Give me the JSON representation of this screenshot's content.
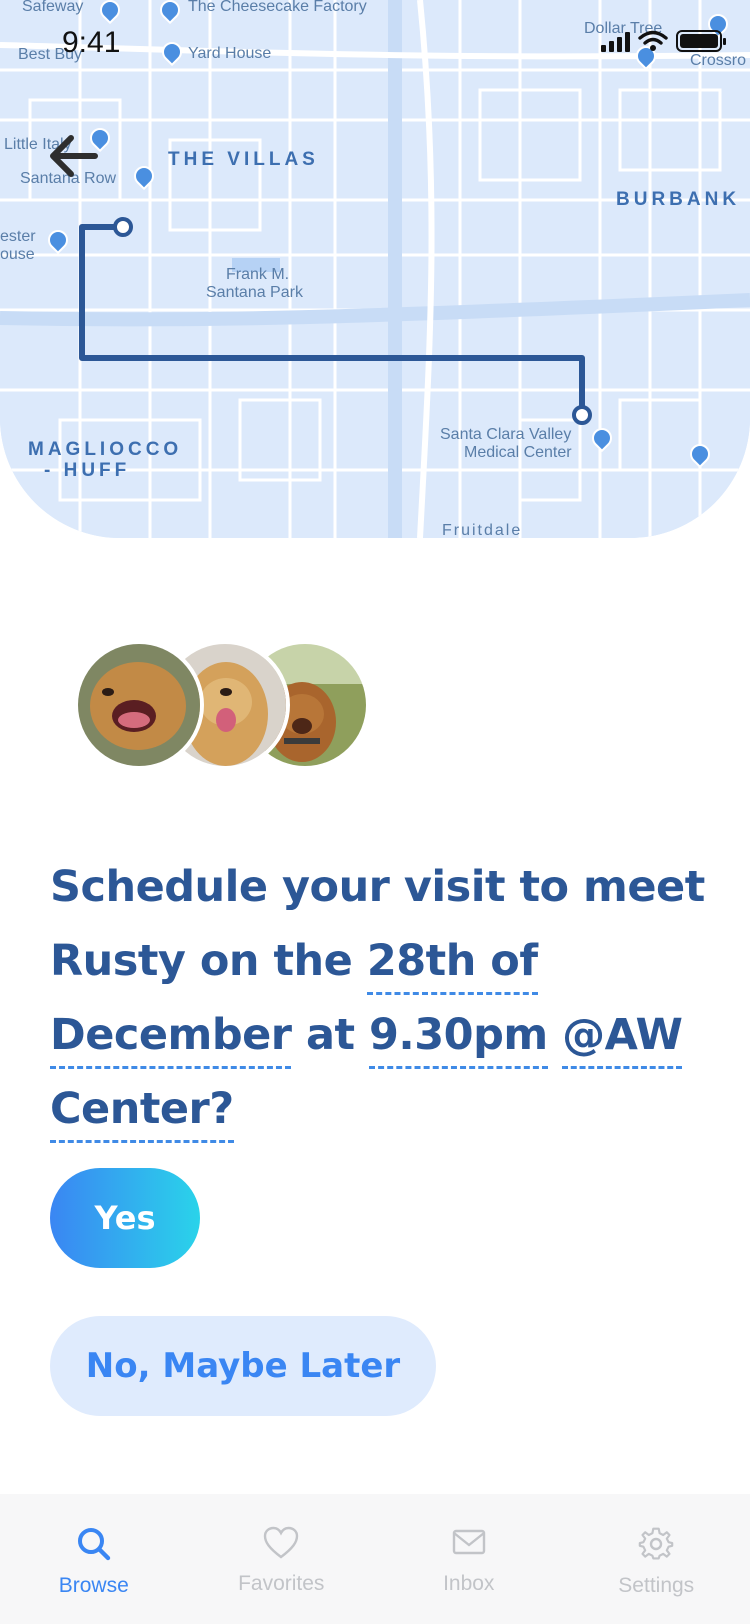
{
  "status_bar": {
    "time": "9:41"
  },
  "map": {
    "places": {
      "safeway": "Safeway",
      "cheesecake": "The Cheesecake Factory",
      "best_buy": "Best Buy",
      "yard_house": "Yard House",
      "dollar_tree": "Dollar Tree",
      "crossroads": "Crossro",
      "little_italy": "Little Italy",
      "santana_row": "Santana Row",
      "winchester": "ester",
      "house": "ouse",
      "frank_park_1": "Frank M.",
      "frank_park_2": "Santana Park",
      "medical_1": "Santa Clara Valley",
      "medical_2": "Medical Center",
      "fruitdale": "Fruitdale"
    },
    "districts": {
      "villas": "THE VILLAS",
      "burbank": "BURBANK",
      "magliocco_1": "MAGLIOCCO",
      "magliocco_2": "- HUFF"
    },
    "route_color": "#2c5796"
  },
  "headline": {
    "part1": "Schedule your visit to meet Rusty on the ",
    "date": "28th of December",
    "part2": " at ",
    "time": "9.30pm",
    "part3": " ",
    "place": "@AW Center?"
  },
  "actions": {
    "yes": "Yes",
    "later": "No, Maybe Later"
  },
  "tabs": [
    {
      "label": "Browse",
      "icon": "search-icon",
      "active": true
    },
    {
      "label": "Favorites",
      "icon": "heart-icon",
      "active": false
    },
    {
      "label": "Inbox",
      "icon": "mail-icon",
      "active": false
    },
    {
      "label": "Settings",
      "icon": "gear-icon",
      "active": false
    }
  ],
  "colors": {
    "accent": "#3a86f3",
    "accent_end": "#2ad3ea",
    "headline": "#2c5796",
    "inactive_tab": "#c2c4c8"
  }
}
